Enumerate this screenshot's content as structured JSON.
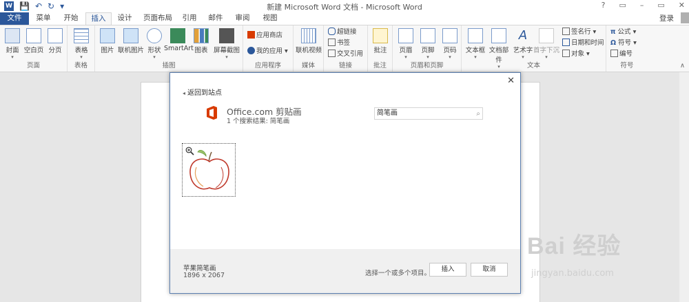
{
  "window": {
    "title": "新建 Microsoft Word 文档 - Microsoft Word",
    "help": "?",
    "restore": "▭",
    "minimize": "–",
    "maximize": "▭",
    "close": "✕"
  },
  "qat": {
    "logo": "W",
    "save": "💾",
    "undo": "↶",
    "redo": "↻",
    "customize": "▾"
  },
  "tabs": [
    "文件",
    "菜单",
    "开始",
    "插入",
    "设计",
    "页面布局",
    "引用",
    "邮件",
    "审阅",
    "视图"
  ],
  "login": "登录",
  "ribbon": {
    "pages": {
      "label": "页面",
      "cover": "封面",
      "blank": "空白页",
      "break": "分页"
    },
    "tables": {
      "label": "表格",
      "table": "表格"
    },
    "illustrations": {
      "label": "插图",
      "picture": "图片",
      "online_picture": "联机图片",
      "shapes": "形状",
      "smartart": "SmartArt",
      "chart": "图表",
      "screenshot": "屏幕截图"
    },
    "apps": {
      "label": "应用程序",
      "store": "应用商店",
      "my_apps": "我的应用"
    },
    "media": {
      "label": "媒体",
      "online_video": "联机视频"
    },
    "links": {
      "label": "链接",
      "hyperlink": "超链接",
      "bookmark": "书签",
      "cross_ref": "交叉引用"
    },
    "comments": {
      "label": "批注",
      "comment": "批注"
    },
    "header_footer": {
      "label": "页眉和页脚",
      "header": "页眉",
      "footer": "页脚",
      "page_number": "页码"
    },
    "text": {
      "label": "文本",
      "textbox": "文本框",
      "quickparts": "文档部件",
      "wordart": "艺术字",
      "dropcap": "首字下沉",
      "signature": "签名行",
      "datetime": "日期和时间",
      "object": "对象"
    },
    "symbols": {
      "label": "符号",
      "equation": "公式",
      "symbol": "符号",
      "number": "编号"
    }
  },
  "dialog": {
    "close": "✕",
    "back": "返回到站点",
    "service_name": "Office.com 剪贴画",
    "result_count": "1 个搜索结果: 简笔画",
    "search_value": "简笔画",
    "clip_name": "苹果简笔画",
    "clip_size": "1896 x 2067",
    "selection_hint": "选择一个或多个项目。",
    "insert_label": "插入",
    "cancel_label": "取消"
  },
  "watermark": {
    "main": "Bai 经验",
    "sub": "jingyan.baidu.com"
  },
  "colors": {
    "accent": "#2b579a",
    "office_orange": "#d83b01"
  }
}
